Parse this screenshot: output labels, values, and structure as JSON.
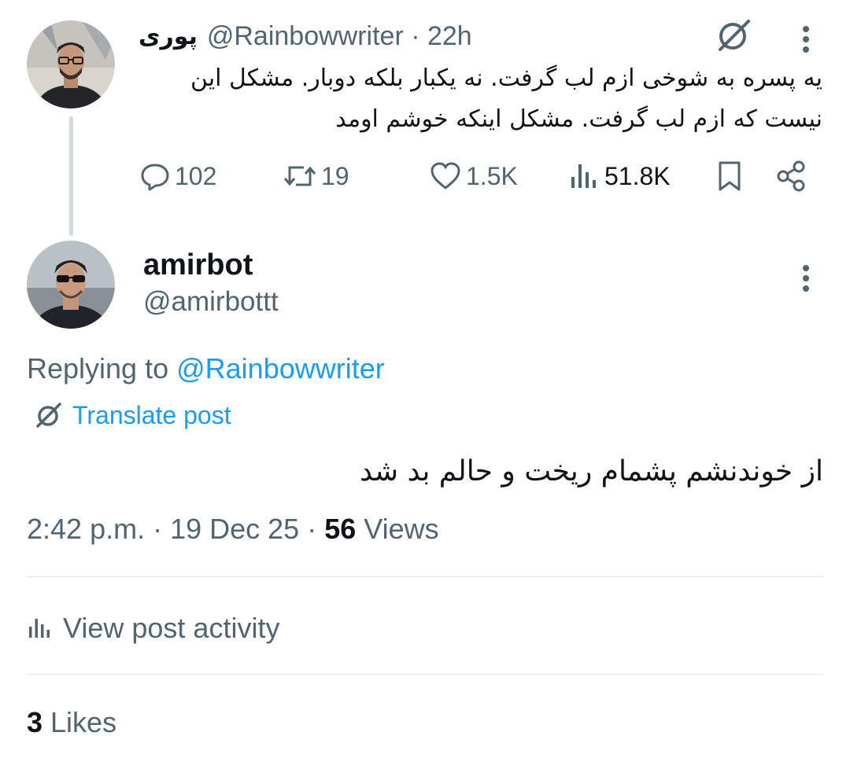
{
  "parent_post": {
    "display_name": "پوری",
    "handle": "@Rainbowwriter",
    "separator": " · ",
    "time_ago": "22h",
    "text": "یه پسره به شوخی ازم لب گرفت. نه یکبار بلکه دوبار. مشکل این نیست که ازم لب گرفت. مشکل اینکه خوشم اومد",
    "actions": {
      "replies": "102",
      "reposts": "19",
      "likes": "1.5K",
      "views": "51.8K"
    }
  },
  "reply_post": {
    "display_name": "amirbot",
    "handle": "@amirbottt",
    "replying_prefix": "Replying to ",
    "replying_to": "@Rainbowwriter",
    "translate_label": "Translate post",
    "text": "از خوندنشم پشمام ریخت و حالم بد شد",
    "time": "2:42 p.m.",
    "sep1": " · ",
    "date": "19 Dec 25",
    "sep2": " · ",
    "views_count": "56",
    "views_label": " Views",
    "activity_label": "View post activity",
    "likes_count": "3",
    "likes_label": " Likes"
  },
  "colors": {
    "accent": "#1d9bf0",
    "secondary_text": "#536471",
    "primary_text": "#0f1419",
    "thread_line": "#cfd9de"
  },
  "icons": [
    "translate-icon",
    "more-icon",
    "reply-icon",
    "repost-icon",
    "like-icon",
    "views-icon",
    "bookmark-icon",
    "share-icon"
  ]
}
